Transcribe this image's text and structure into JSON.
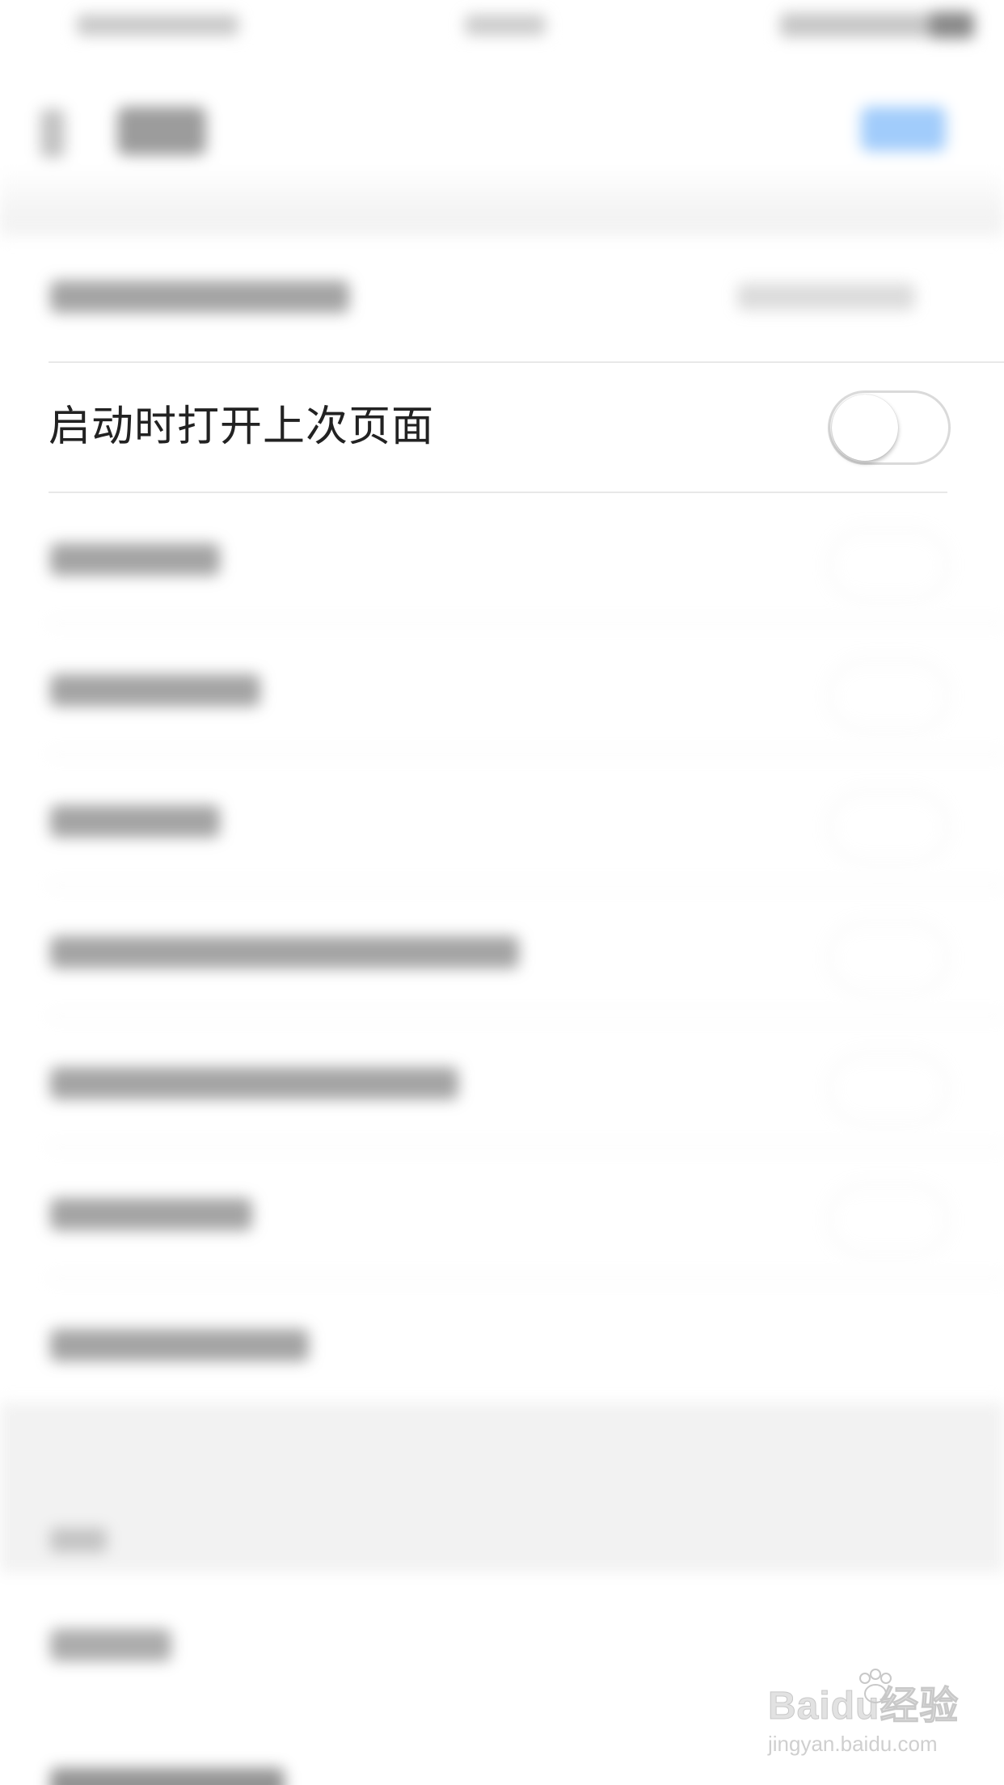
{
  "settings": {
    "launch_row": {
      "label": "启动时打开上次页面",
      "toggle_on": false
    }
  },
  "watermark": {
    "logo": "Baidu经验",
    "site": "jingyan.baidu.com"
  }
}
